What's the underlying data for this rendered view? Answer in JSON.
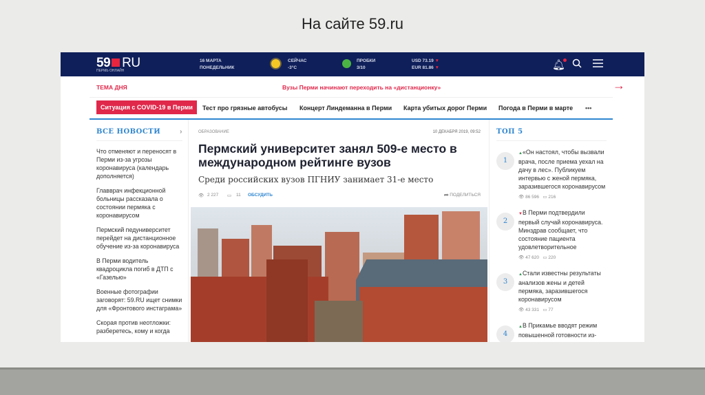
{
  "slide": {
    "title": "На сайте 59.ru"
  },
  "header": {
    "logo_num": "59",
    "logo_ru": "RU",
    "logo_sub": "ПЕРМЬ ОНЛАЙН",
    "date_line1": "16 МАРТА",
    "date_line2": "ПОНЕДЕЛЬНИК",
    "weather_label": "СЕЙЧАС",
    "weather_value": "-3°C",
    "traffic_label": "ПРОБКИ",
    "traffic_value": "3/10",
    "usd": "USD 73.19",
    "eur": "EUR 81.86",
    "down_mark": "▼"
  },
  "theme": {
    "label": "ТЕМА ДНЯ",
    "headline": "Вузы Перми начинают переходить на «дистанционку»",
    "arrow": "→"
  },
  "nav": {
    "items": [
      "Ситуация с COVID-19 в Перми",
      "Тест про грязные автобусы",
      "Концерт Линдеманна в Перми",
      "Карта убитых дорог Перми",
      "Погода в Перми в марте"
    ],
    "more": "•••"
  },
  "all_news": {
    "title": "ВСЕ НОВОСТИ",
    "chevron": "›",
    "items": [
      "Что отменяют и переносят в Перми из-за угрозы коронавируса (календарь дополняется)",
      "Главврач инфекционной больницы рассказала о состоянии пермяка с коронавирусом",
      "Пермский педуниверситет перейдет на дистанционное обучение из-за коронавируса",
      "В Перми водитель квадроцикла погиб в ДТП с «Газелью»",
      "Военные фотографии заговорят: 59.RU ищет снимки для «Фронтового инстаграма»",
      "Скорая против неотложки: разберетесь, кому и когда"
    ]
  },
  "article": {
    "rubric": "ОБРАЗОВАНИЕ",
    "date": "10 ДЕКАБРЯ 2019, 09:52",
    "title": "Пермский университет занял 509-е место в международном рейтинге вузов",
    "lead": "Среди российских вузов ПГНИУ занимает 31-е место",
    "views": "2 227",
    "comments": "11",
    "discuss": "ОБСУДИТЬ",
    "share": "ПОДЕЛИТЬСЯ"
  },
  "top5": {
    "title": "ТОП 5",
    "items": [
      {
        "num": "1",
        "trend": "▲",
        "text": "«Он настоял, чтобы вызвали врача, после приема уехал на дачу в лес». Публикуем интервью с женой пермяка, заразившегося коронавирусом",
        "views": "86 596",
        "comments": "216"
      },
      {
        "num": "2",
        "trend": "▼",
        "text": "В Перми подтвердили первый случай коронавируса. Минздрав сообщает, что состояние пациента удовлетворительное",
        "views": "47 620",
        "comments": "220"
      },
      {
        "num": "3",
        "trend": "▲",
        "text": "Стали известны результаты анализов жены и детей пермяка, заразившегося коронавирусом",
        "views": "43 331",
        "comments": "77"
      },
      {
        "num": "4",
        "trend": "▲",
        "text": "В Прикамье вводят режим повышенной готовности из-"
      }
    ]
  },
  "colors": {
    "navy": "#0f1f5a",
    "accent_red": "#e0284b",
    "accent_blue": "#2f86d1"
  }
}
